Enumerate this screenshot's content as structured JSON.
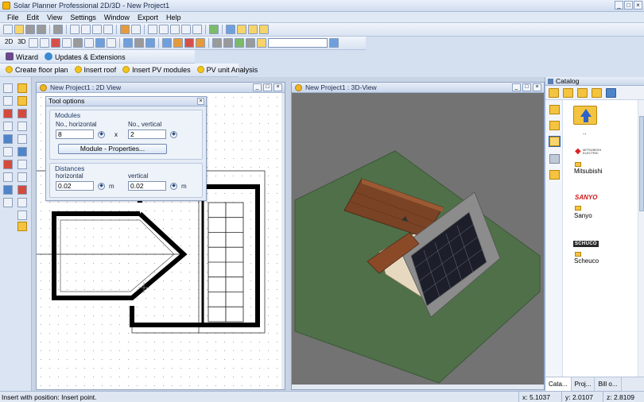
{
  "window": {
    "title": "Solar Planner Professional 2D/3D - New Project1",
    "min": "_",
    "max": "□",
    "close": "×"
  },
  "menu": [
    "File",
    "Edit",
    "View",
    "Settings",
    "Window",
    "Export",
    "Help"
  ],
  "toolbar3": {
    "wizard": "Wizard",
    "updates": "Updates & Extensions"
  },
  "toolbar4": {
    "items": [
      "Create floor plan",
      "Insert roof",
      "Insert PV modules",
      "PV unit Analysis"
    ]
  },
  "view2d": {
    "title": "New Project1 : 2D View"
  },
  "view3d": {
    "title": "New Project1 : 3D-View"
  },
  "tool_options": {
    "title": "Tool options",
    "modules_group": "Modules",
    "horizontal_label": "No., horizontal",
    "vertical_label": "No., vertical",
    "horizontal_value": "8",
    "vertical_value": "2",
    "times": "x",
    "properties_button": "Module - Properties...",
    "distances_group": "Distances",
    "dist_h_label": "horizontal",
    "dist_v_label": "vertical",
    "dist_h_value": "0.02",
    "dist_v_value": "0.02",
    "unit": "m"
  },
  "catalog": {
    "title": "Catalog",
    "up_label": "..",
    "entries": [
      {
        "name": "Mitsubishi",
        "logo": "MITSUBISHI ELECTRIC"
      },
      {
        "name": "Sanyo",
        "logo": "SANYO"
      },
      {
        "name": "Scheuco",
        "logo": "SCHÜCO"
      }
    ],
    "tabs": [
      "Cata...",
      "Proj...",
      "Bill o..."
    ]
  },
  "status": {
    "text": "Insert with position: Insert point.",
    "x": "x: 5.1037",
    "y": "y: 2.0107",
    "z": "z: 2.8109"
  }
}
